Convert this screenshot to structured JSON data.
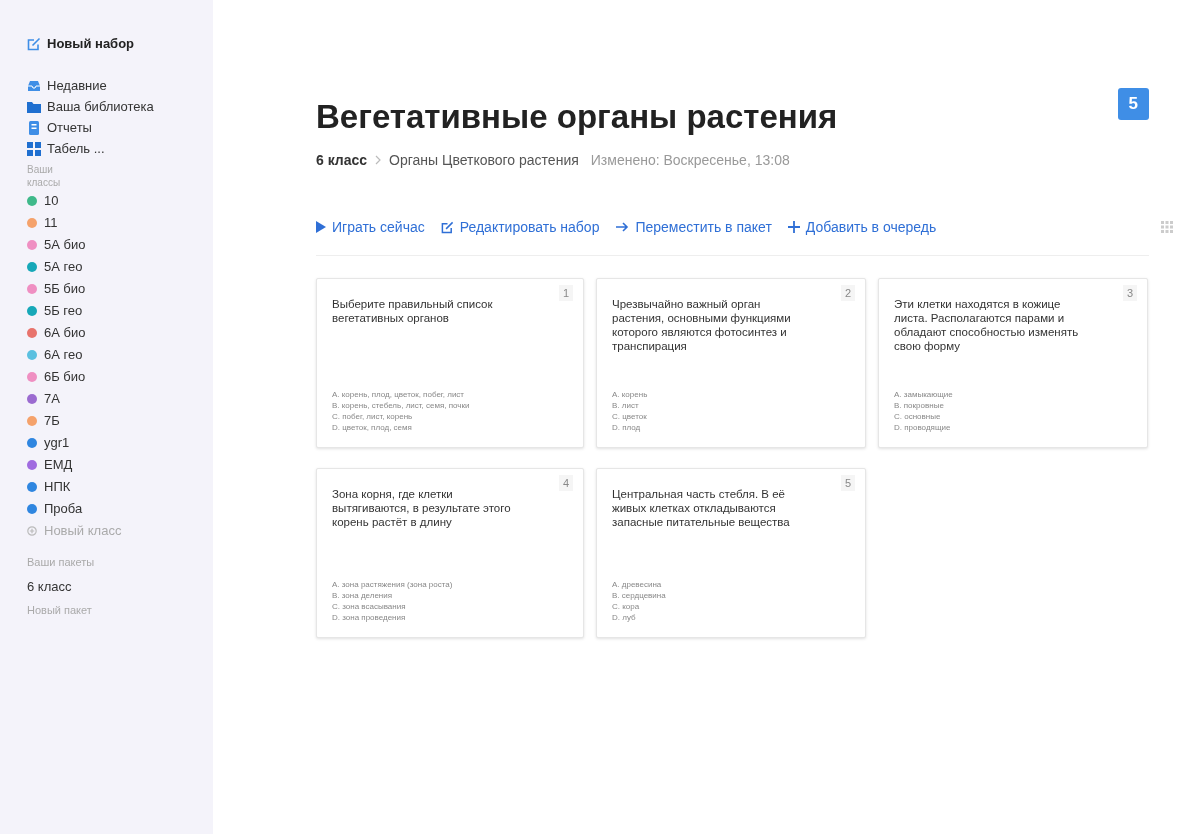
{
  "sidebar": {
    "new_set": "Новый набор",
    "nav": [
      {
        "kind": "recent",
        "label": "Недавние"
      },
      {
        "kind": "library",
        "label": "Ваша библиотека"
      },
      {
        "kind": "reports",
        "label": "Отчеты"
      },
      {
        "kind": "grid",
        "label": "Табель ..."
      }
    ],
    "classes_heading": "Ваши классы",
    "classes": [
      {
        "label": "10",
        "color": "#3fb98a"
      },
      {
        "label": "11",
        "color": "#f5a26b"
      },
      {
        "label": "5А био",
        "color": "#ef8fc2"
      },
      {
        "label": "5А гео",
        "color": "#17a8b8"
      },
      {
        "label": "5Б био",
        "color": "#ef8fc2"
      },
      {
        "label": "5Б гео",
        "color": "#17a8b8"
      },
      {
        "label": "6А био",
        "color": "#e8736c"
      },
      {
        "label": "6А гео",
        "color": "#5bc0e0"
      },
      {
        "label": "6Б био",
        "color": "#ef8fc2"
      },
      {
        "label": "7А",
        "color": "#9b6bd0"
      },
      {
        "label": "7Б",
        "color": "#f5a26b"
      },
      {
        "label": "ygr1",
        "color": "#2f86e0"
      },
      {
        "label": "ЕМД",
        "color": "#a06be0"
      },
      {
        "label": "НПК",
        "color": "#2f86e0"
      },
      {
        "label": "Проба",
        "color": "#2f86e0"
      }
    ],
    "new_class": "Новый класс",
    "packs_heading": "Ваши пакеты",
    "packs": [
      "6 класс"
    ],
    "new_pack": "Новый пакет"
  },
  "header": {
    "title": "Вегетативные органы растения",
    "count": "5",
    "breadcrumb": [
      "6 класс",
      "Органы Цветкового растения"
    ],
    "modified": "Изменено: Воскресенье, 13:08"
  },
  "actions": [
    {
      "kind": "play",
      "label": "Играть сейчас"
    },
    {
      "kind": "edit",
      "label": "Редактировать набор"
    },
    {
      "kind": "move",
      "label": "Переместить в пакет"
    },
    {
      "kind": "add",
      "label": "Добавить в очередь"
    }
  ],
  "cards": [
    {
      "number": "1",
      "question": "Выберите правильный список вегетативных органов",
      "answers": [
        "A. корень, плод, цветок, побег, лист",
        "B. корень, стебель, лист, семя, почки",
        "C. побег, лист, корень",
        "D. цветок, плод, семя"
      ]
    },
    {
      "number": "2",
      "question": "Чрезвычайно важный орган растения, основными функциями которого являются фотосинтез и транспирация",
      "answers": [
        "A. корень",
        "B. лист",
        "C. цветок",
        "D. плод"
      ]
    },
    {
      "number": "3",
      "question": "Эти клетки находятся в кожице листа. Располагаются парами и обладают способностью изменять свою форму",
      "answers": [
        "A. замыкающие",
        "B. покровные",
        "C. основные",
        "D. проводящие"
      ]
    },
    {
      "number": "4",
      "question": "Зона корня, где клетки вытягиваются, в результате этого корень растёт в длину",
      "answers": [
        "A. зона растяжения (зона роста)",
        "B. зона деления",
        "C. зона всасывания",
        "D. зона проведения"
      ]
    },
    {
      "number": "5",
      "question": "Центральная часть стебля. В её живых клетках откладываются запасные питательные вещества",
      "answers": [
        "A. древесина",
        "B. сердцевина",
        "C. кора",
        "D. луб"
      ]
    }
  ]
}
